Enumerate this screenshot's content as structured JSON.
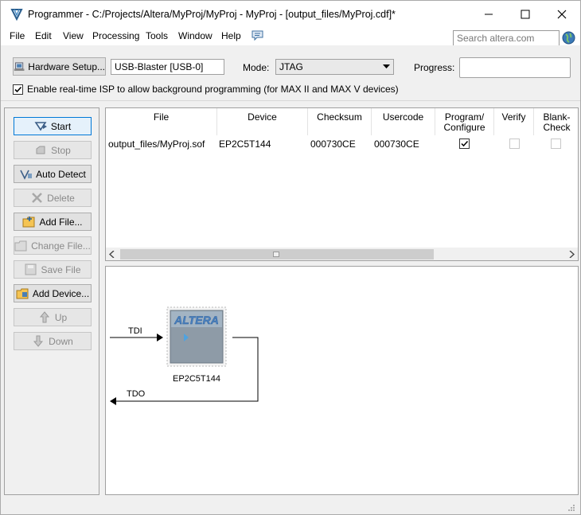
{
  "window": {
    "title": "Programmer - C:/Projects/Altera/MyProj/MyProj - MyProj - [output_files/MyProj.cdf]*",
    "controls": {
      "minimize": "minimize-icon",
      "maximize": "maximize-icon",
      "close": "close-icon"
    }
  },
  "menu": {
    "items": [
      "File",
      "Edit",
      "View",
      "Processing",
      "Tools",
      "Window",
      "Help"
    ],
    "search_placeholder": "Search altera.com"
  },
  "hardware": {
    "setup_label": "Hardware Setup...",
    "device_value": "USB-Blaster [USB-0]",
    "mode_label": "Mode:",
    "mode_value": "JTAG",
    "progress_label": "Progress:",
    "progress_value": "",
    "isp_label": "Enable real-time ISP to allow background programming (for MAX II and MAX V devices)",
    "isp_checked": true
  },
  "sidebar": {
    "buttons": [
      {
        "label": "Start",
        "enabled": true
      },
      {
        "label": "Stop",
        "enabled": false
      },
      {
        "label": "Auto Detect",
        "enabled": true
      },
      {
        "label": "Delete",
        "enabled": false
      },
      {
        "label": "Add File...",
        "enabled": true
      },
      {
        "label": "Change File...",
        "enabled": false
      },
      {
        "label": "Save File",
        "enabled": false
      },
      {
        "label": "Add Device...",
        "enabled": true
      },
      {
        "label": "Up",
        "enabled": false
      },
      {
        "label": "Down",
        "enabled": false
      }
    ]
  },
  "table": {
    "headers": [
      "File",
      "Device",
      "Checksum",
      "Usercode",
      "Program/\nConfigure",
      "Verify",
      "Blank-\nCheck"
    ],
    "rows": [
      {
        "file": "output_files/MyProj.sof",
        "device": "EP2C5T144",
        "checksum": "000730CE",
        "usercode": "000730CE",
        "program": true,
        "verify": false,
        "blank_check": false
      }
    ]
  },
  "chain": {
    "tdi_label": "TDI",
    "tdo_label": "TDO",
    "chip_logo": "ALTERA",
    "device_name": "EP2C5T144"
  },
  "colors": {
    "accent": "#3c7fb1",
    "chip_body": "#8c9aa6"
  }
}
